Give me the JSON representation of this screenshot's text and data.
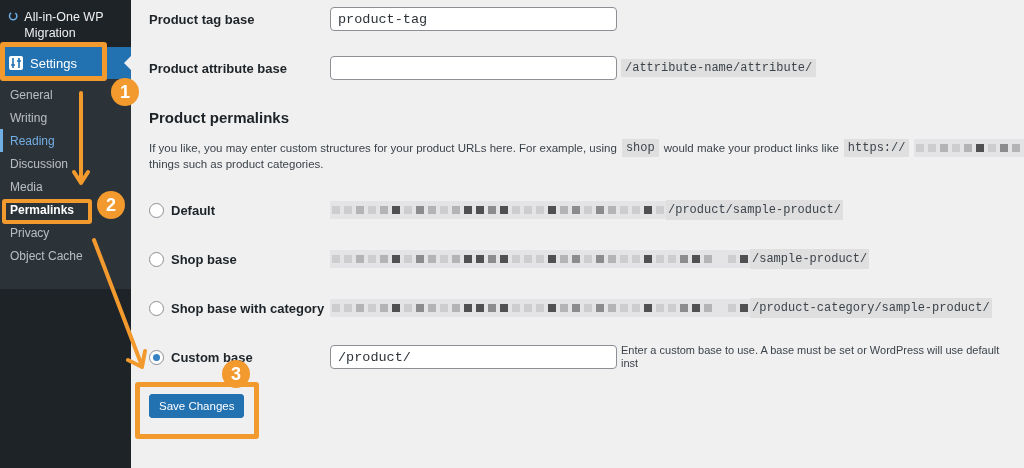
{
  "sidebar": {
    "plugin_item": {
      "label": "All-in-One WP Migration"
    },
    "menu_item": {
      "label": "Settings",
      "selected": true
    },
    "submenu": [
      {
        "label": "General",
        "selected": false,
        "hovered": false
      },
      {
        "label": "Writing",
        "selected": false,
        "hovered": false
      },
      {
        "label": "Reading",
        "selected": false,
        "hovered": true
      },
      {
        "label": "Discussion",
        "selected": false,
        "hovered": false
      },
      {
        "label": "Media",
        "selected": false,
        "hovered": false
      },
      {
        "label": "Permalinks",
        "selected": true,
        "hovered": false
      },
      {
        "label": "Privacy",
        "selected": false,
        "hovered": false
      },
      {
        "label": "Object Cache",
        "selected": false,
        "hovered": false
      }
    ]
  },
  "fields": [
    {
      "label": "Product tag base",
      "value": "product-tag"
    },
    {
      "label": "Product attribute base",
      "suffix": "/attribute-name/attribute/"
    }
  ],
  "permalinks": {
    "heading": "Product permalinks",
    "description": {
      "before": "If you like, you may enter custom structures for your product URLs here. For example, using",
      "code": "shop",
      "middle": "would make your product links like",
      "url": "https://",
      "after": "things such as product categories."
    },
    "options": [
      {
        "kind": "preset",
        "label": "Default",
        "selected": false,
        "path": "/product/sample-product/"
      },
      {
        "kind": "preset",
        "label": "Shop base",
        "selected": false,
        "path": "/sample-product/"
      },
      {
        "kind": "preset",
        "label": "Shop base with category",
        "selected": false,
        "path": "/product-category/sample-product/"
      },
      {
        "kind": "custom",
        "label": "Custom base",
        "selected": true,
        "value": "/product/",
        "hint": "Enter a custom base to use. A base must be set or WordPress will use default inst"
      }
    ]
  },
  "save_button": "Save Changes",
  "annotations": [
    {
      "number": "1"
    },
    {
      "number": "2"
    },
    {
      "number": "3"
    }
  ]
}
